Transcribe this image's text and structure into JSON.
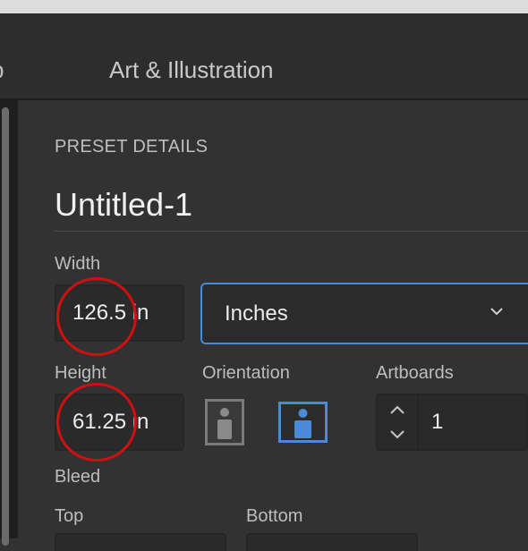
{
  "header": {
    "partial_tab_label": "p",
    "active_tab_label": "Art & Illustration"
  },
  "preset": {
    "section_title": "PRESET DETAILS",
    "document_name": "Untitled-1",
    "width": {
      "label": "Width",
      "value": "126.5 in"
    },
    "units": {
      "selected": "Inches"
    },
    "height": {
      "label": "Height",
      "value": "61.25 in"
    },
    "orientation": {
      "label": "Orientation",
      "selected": "landscape"
    },
    "artboards": {
      "label": "Artboards",
      "value": "1"
    },
    "bleed": {
      "label": "Bleed",
      "top_label": "Top",
      "bottom_label": "Bottom"
    }
  },
  "colors": {
    "accent": "#4a8bd8",
    "highlight_circle": "#d01010"
  }
}
